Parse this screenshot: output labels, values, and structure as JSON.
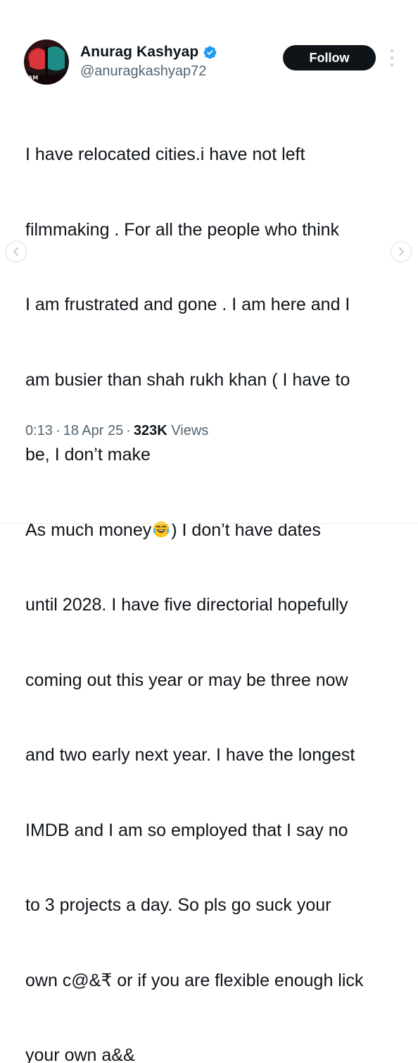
{
  "author": {
    "name": "Anurag Kashyap",
    "handle": "@anuragkashyap72",
    "avatar_badge_text": "AM"
  },
  "actions": {
    "follow_label": "Follow"
  },
  "tweet": {
    "lines": [
      "I have relocated cities.i have not left",
      "filmmaking . For all the people who think",
      "I am frustrated and gone . I am here and I",
      "am busier than shah rukh khan ( I have to",
      "be, I don’t make",
      "As much money",
      ") I don’t have dates",
      "until 2028. I have five directorial hopefully",
      "coming out this year or may be three now",
      "and two early next year. I have the longest",
      "IMDB and I am so employed that I say no",
      "to 3 projects a day. So pls go suck your",
      "own c@&₹ or if you are flexible enough lick",
      "your own a&&"
    ],
    "emoji": "laughing-crying-emoji"
  },
  "meta": {
    "time": "0:13",
    "sep1": "·",
    "date": "18 Apr 25",
    "sep2": "·",
    "views_count": "323K",
    "views_label": "Views"
  },
  "nav": {
    "prev_icon": "chevron-left-icon",
    "next_icon": "chevron-right-icon"
  },
  "colors": {
    "text": "#0f1419",
    "secondary": "#536471",
    "verified_blue": "#1d9bf0",
    "button_bg": "#0f1419"
  }
}
